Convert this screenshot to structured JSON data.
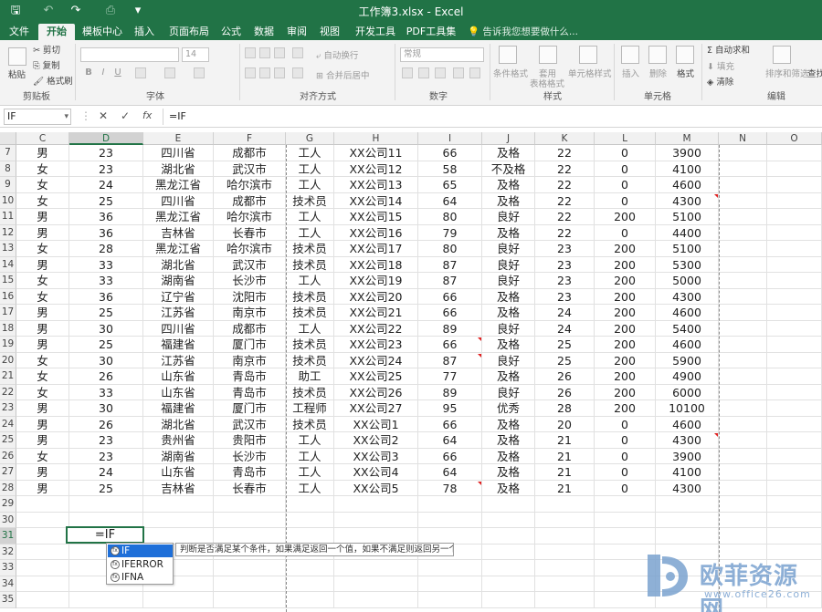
{
  "window": {
    "title": "工作簿3.xlsx - Excel"
  },
  "tabs": [
    "文件",
    "开始",
    "模板中心",
    "插入",
    "页面布局",
    "公式",
    "数据",
    "审阅",
    "视图",
    "开发工具",
    "PDF工具集"
  ],
  "tell_me": "告诉我您想要做什么...",
  "ribbon": {
    "clipboard": {
      "paste": "粘贴",
      "cut": "剪切",
      "copy": "复制",
      "painter": "格式刷",
      "label": "剪贴板"
    },
    "font": {
      "size": "14",
      "label": "字体"
    },
    "alignment": {
      "wrap": "自动换行",
      "merge": "合并后居中",
      "label": "对齐方式"
    },
    "number": {
      "format": "常规",
      "label": "数字"
    },
    "styles": {
      "conditional": "条件格式",
      "table": "套用",
      "table2": "表格格式",
      "cell_style": "单元格样式",
      "label": "样式"
    },
    "cells": {
      "insert": "插入",
      "delete": "删除",
      "format": "格式",
      "label": "单元格"
    },
    "editing": {
      "autosum": "自动求和",
      "fill": "填充",
      "clear": "清除",
      "sort": "排序和筛选",
      "find": "查找",
      "label": "编辑"
    }
  },
  "formula_bar": {
    "name_box": "IF",
    "formula": "=IF"
  },
  "columns": [
    "C",
    "D",
    "E",
    "F",
    "G",
    "H",
    "I",
    "J",
    "K",
    "L",
    "M",
    "N",
    "O"
  ],
  "rows": [
    {
      "n": "7",
      "c": [
        "男",
        "23",
        "四川省",
        "成都市",
        "工人",
        "XX公司11",
        "66",
        "及格",
        "22",
        "0",
        "3900"
      ]
    },
    {
      "n": "8",
      "c": [
        "女",
        "23",
        "湖北省",
        "武汉市",
        "工人",
        "XX公司12",
        "58",
        "不及格",
        "22",
        "0",
        "4100"
      ]
    },
    {
      "n": "9",
      "c": [
        "女",
        "24",
        "黑龙江省",
        "哈尔滨市",
        "工人",
        "XX公司13",
        "65",
        "及格",
        "22",
        "0",
        "4600"
      ]
    },
    {
      "n": "10",
      "c": [
        "女",
        "25",
        "四川省",
        "成都市",
        "技术员",
        "XX公司14",
        "64",
        "及格",
        "22",
        "0",
        "4300"
      ]
    },
    {
      "n": "11",
      "c": [
        "男",
        "36",
        "黑龙江省",
        "哈尔滨市",
        "工人",
        "XX公司15",
        "80",
        "良好",
        "22",
        "200",
        "5100"
      ]
    },
    {
      "n": "12",
      "c": [
        "男",
        "36",
        "吉林省",
        "长春市",
        "工人",
        "XX公司16",
        "79",
        "及格",
        "22",
        "0",
        "4400"
      ]
    },
    {
      "n": "13",
      "c": [
        "女",
        "28",
        "黑龙江省",
        "哈尔滨市",
        "技术员",
        "XX公司17",
        "80",
        "良好",
        "23",
        "200",
        "5100"
      ]
    },
    {
      "n": "14",
      "c": [
        "男",
        "33",
        "湖北省",
        "武汉市",
        "技术员",
        "XX公司18",
        "87",
        "良好",
        "23",
        "200",
        "5300"
      ]
    },
    {
      "n": "15",
      "c": [
        "女",
        "33",
        "湖南省",
        "长沙市",
        "工人",
        "XX公司19",
        "87",
        "良好",
        "23",
        "200",
        "5000"
      ]
    },
    {
      "n": "16",
      "c": [
        "女",
        "36",
        "辽宁省",
        "沈阳市",
        "技术员",
        "XX公司20",
        "66",
        "及格",
        "23",
        "200",
        "4300"
      ]
    },
    {
      "n": "17",
      "c": [
        "男",
        "25",
        "江苏省",
        "南京市",
        "技术员",
        "XX公司21",
        "66",
        "及格",
        "24",
        "200",
        "4600"
      ]
    },
    {
      "n": "18",
      "c": [
        "男",
        "30",
        "四川省",
        "成都市",
        "工人",
        "XX公司22",
        "89",
        "良好",
        "24",
        "200",
        "5400"
      ]
    },
    {
      "n": "19",
      "c": [
        "男",
        "25",
        "福建省",
        "厦门市",
        "技术员",
        "XX公司23",
        "66",
        "及格",
        "25",
        "200",
        "4600"
      ]
    },
    {
      "n": "20",
      "c": [
        "女",
        "30",
        "江苏省",
        "南京市",
        "技术员",
        "XX公司24",
        "87",
        "良好",
        "25",
        "200",
        "5900"
      ]
    },
    {
      "n": "21",
      "c": [
        "女",
        "26",
        "山东省",
        "青岛市",
        "助工",
        "XX公司25",
        "77",
        "及格",
        "26",
        "200",
        "4900"
      ]
    },
    {
      "n": "22",
      "c": [
        "女",
        "33",
        "山东省",
        "青岛市",
        "技术员",
        "XX公司26",
        "89",
        "良好",
        "26",
        "200",
        "6000"
      ]
    },
    {
      "n": "23",
      "c": [
        "男",
        "30",
        "福建省",
        "厦门市",
        "工程师",
        "XX公司27",
        "95",
        "优秀",
        "28",
        "200",
        "10100"
      ]
    },
    {
      "n": "24",
      "c": [
        "男",
        "26",
        "湖北省",
        "武汉市",
        "技术员",
        "XX公司1",
        "66",
        "及格",
        "20",
        "0",
        "4600"
      ]
    },
    {
      "n": "25",
      "c": [
        "男",
        "23",
        "贵州省",
        "贵阳市",
        "工人",
        "XX公司2",
        "64",
        "及格",
        "21",
        "0",
        "4300"
      ]
    },
    {
      "n": "26",
      "c": [
        "女",
        "23",
        "湖南省",
        "长沙市",
        "工人",
        "XX公司3",
        "66",
        "及格",
        "21",
        "0",
        "3900"
      ]
    },
    {
      "n": "27",
      "c": [
        "男",
        "24",
        "山东省",
        "青岛市",
        "工人",
        "XX公司4",
        "64",
        "及格",
        "21",
        "0",
        "4100"
      ]
    },
    {
      "n": "28",
      "c": [
        "男",
        "25",
        "吉林省",
        "长春市",
        "工人",
        "XX公司5",
        "78",
        "及格",
        "21",
        "0",
        "4300"
      ]
    },
    {
      "n": "29",
      "c": []
    },
    {
      "n": "30",
      "c": []
    },
    {
      "n": "31",
      "c": []
    },
    {
      "n": "32",
      "c": []
    },
    {
      "n": "33",
      "c": []
    },
    {
      "n": "34",
      "c": []
    },
    {
      "n": "35",
      "c": []
    }
  ],
  "active_cell": {
    "value": "=IF"
  },
  "autocomplete": {
    "items": [
      "IF",
      "IFERROR",
      "IFNA"
    ],
    "tooltip": "判断是否满足某个条件，如果满足返回一个值，如果不满足则返回另一个值。"
  },
  "watermark": {
    "text": "欧菲资源网",
    "url": "www.office26.com"
  }
}
